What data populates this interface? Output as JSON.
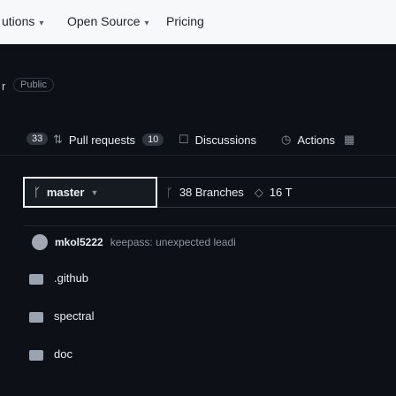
{
  "topnav": {
    "items": [
      "utions",
      "Open Source",
      "Pricing"
    ]
  },
  "repo": {
    "name_fragment": "r",
    "visibility": "Public"
  },
  "tabs": [
    {
      "label": "",
      "count": "33"
    },
    {
      "label": "Pull requests",
      "count": "10"
    },
    {
      "label": "Discussions",
      "count": ""
    },
    {
      "label": "Actions",
      "count": ""
    }
  ],
  "branch": {
    "current": "master",
    "branches_label": "38 Branches",
    "tags_label": "16 T"
  },
  "commit": {
    "author": "mkol5222",
    "message": "keepass: unexpected leadi"
  },
  "files": [
    {
      "name": ".github"
    },
    {
      "name": "spectral"
    },
    {
      "name": "doc"
    }
  ]
}
